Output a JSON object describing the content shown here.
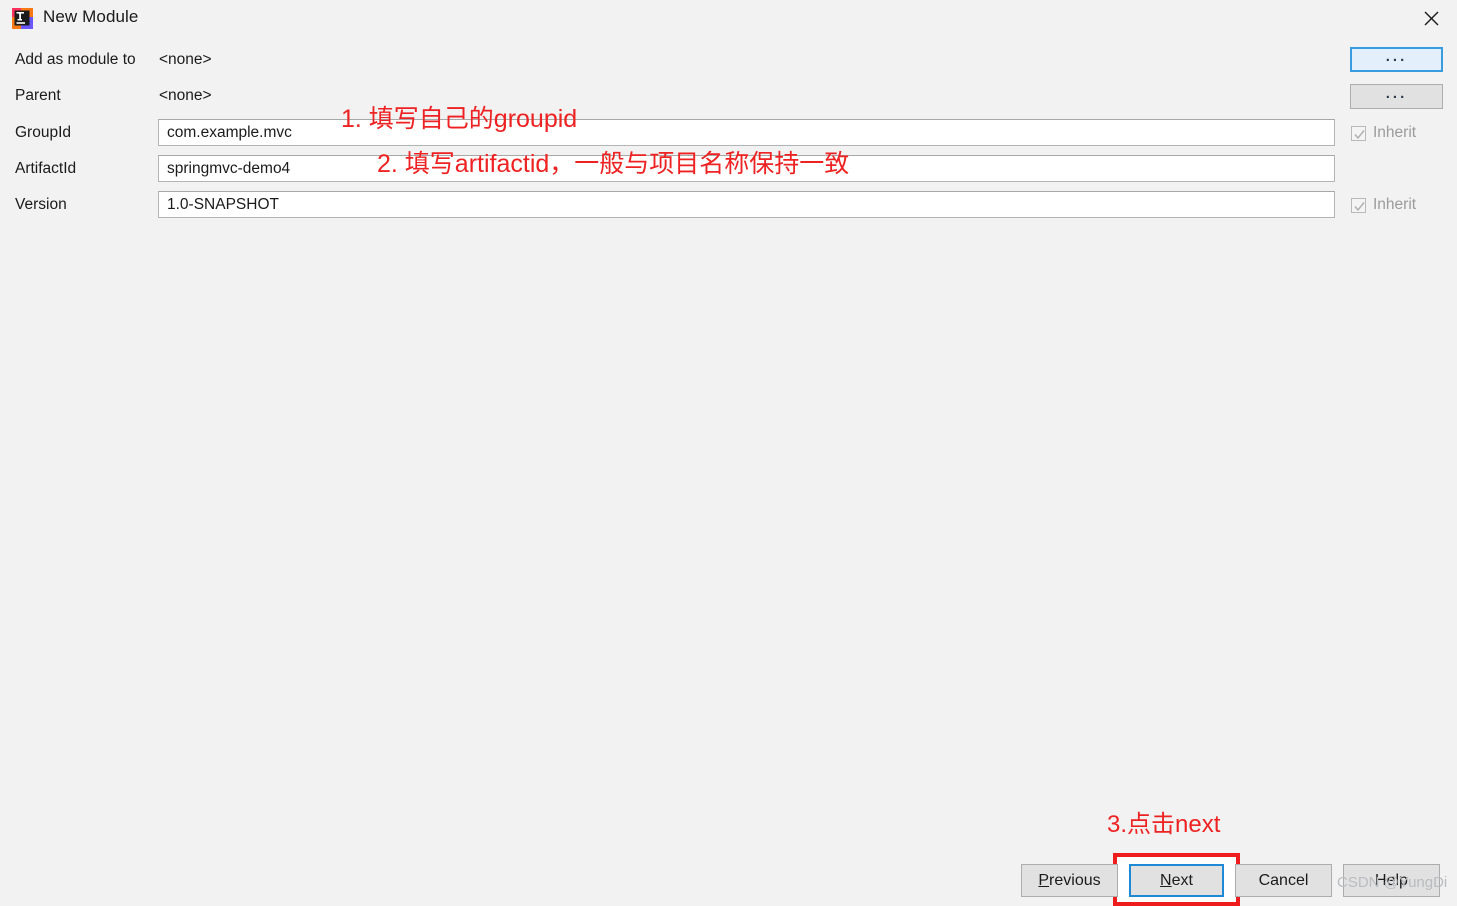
{
  "window": {
    "title": "New Module",
    "app_icon": "intellij-idea-icon",
    "close_icon": "close-icon"
  },
  "form": {
    "rows": [
      {
        "label": "Add as module to",
        "value": "<none>"
      },
      {
        "label": "Parent",
        "value": "<none>"
      },
      {
        "label": "GroupId",
        "value": "com.example.mvc"
      },
      {
        "label": "ArtifactId",
        "value": "springmvc-demo4"
      },
      {
        "label": "Version",
        "value": "1.0-SNAPSHOT"
      }
    ],
    "browse_buttons": [
      {
        "label": "...",
        "state": "focused"
      },
      {
        "label": "...",
        "state": "normal"
      }
    ],
    "inherit_checkboxes": [
      {
        "label": "Inherit",
        "checked": true,
        "disabled": true
      },
      {
        "label": "Inherit",
        "checked": true,
        "disabled": true
      }
    ]
  },
  "annotations": {
    "color": "#ee2222",
    "items": [
      {
        "text": "1. 填写自己的groupid"
      },
      {
        "text": "2. 填写artifactid，一般与项目名称保持一致"
      },
      {
        "text": "3.点击next"
      }
    ]
  },
  "buttons": {
    "previous": {
      "prefix": "P",
      "rest": "revious"
    },
    "next": {
      "prefix": "N",
      "rest": "ext"
    },
    "cancel": "Cancel",
    "help": "Help"
  },
  "watermark": "CSDN @YungDi"
}
